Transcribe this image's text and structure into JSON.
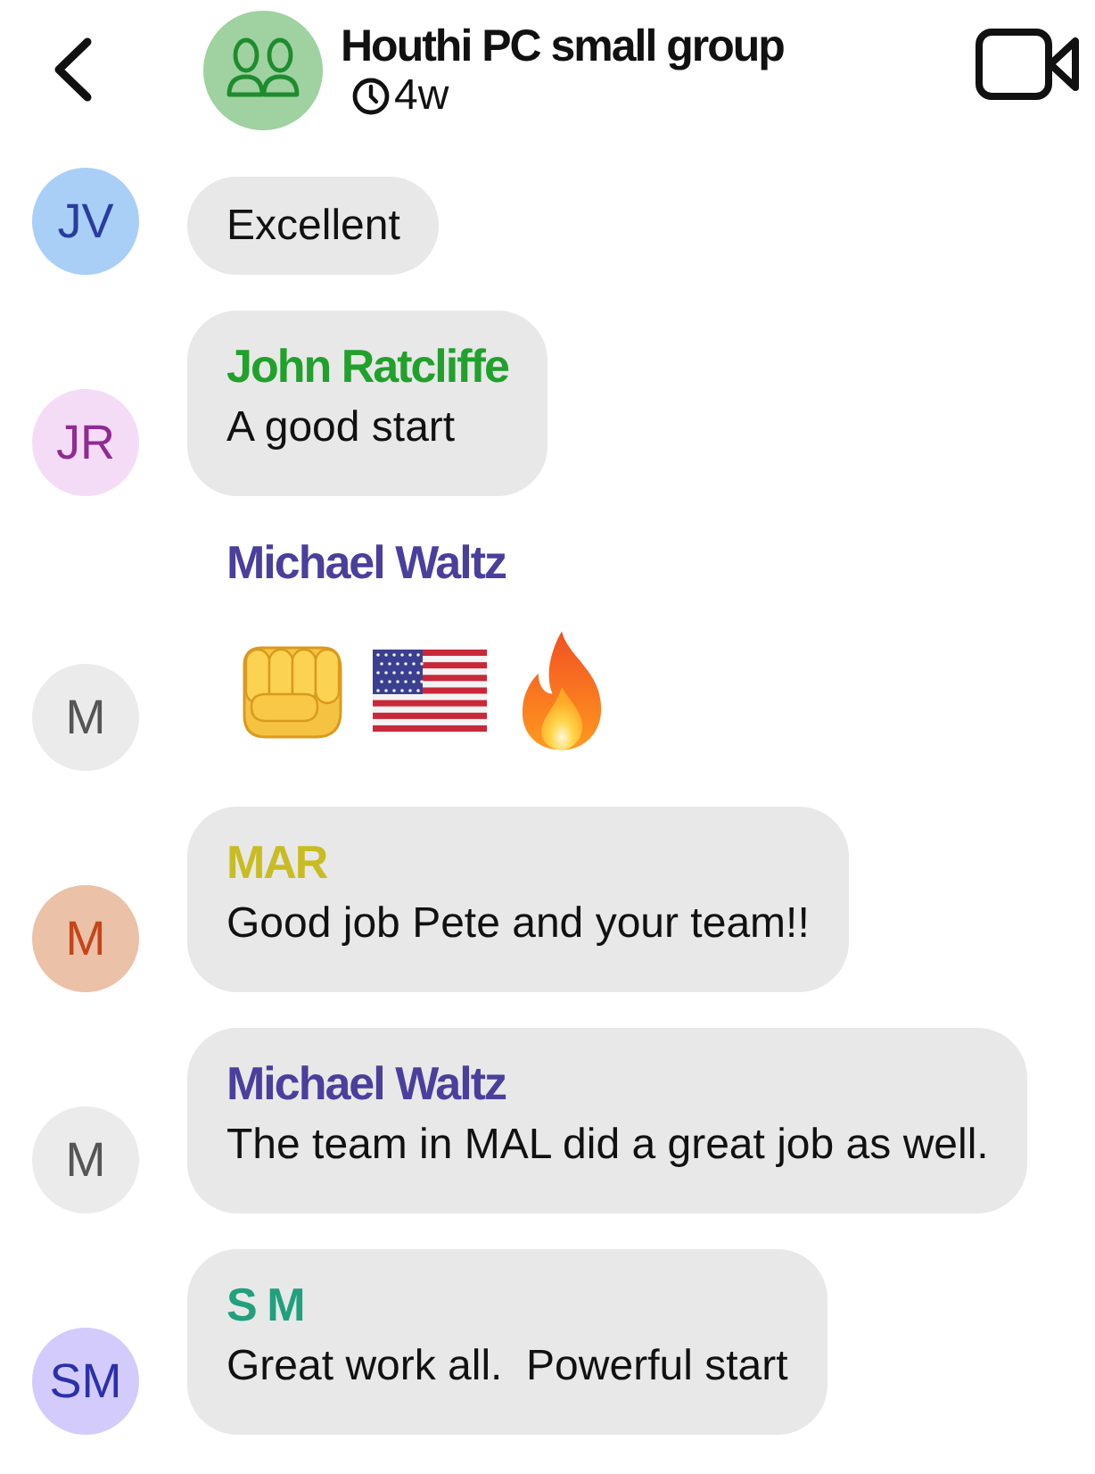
{
  "header": {
    "title": "Houthi PC small group",
    "subtitle": "4w"
  },
  "messages": [
    {
      "kind": "text",
      "avatar": {
        "color": "#a9cff7",
        "initials": {
          "text": "JV",
          "color": "#2a3d9c"
        }
      },
      "text": "Excellent"
    },
    {
      "kind": "text",
      "avatar": {
        "color": "#f4dcf6",
        "initials": {
          "text": "JR",
          "color": "#8f2b91"
        }
      },
      "sender": {
        "name": "John Ratcliffe",
        "color": "#22a02c"
      },
      "text": "A good start"
    },
    {
      "kind": "emoji",
      "avatar": {
        "color": "#ebebeb",
        "initials": {
          "text": "M",
          "color": "#555555"
        }
      },
      "sender": {
        "name": "Michael Waltz",
        "color": "#4a3f9c"
      },
      "emojis": [
        {
          "kind": "fist"
        },
        {
          "kind": "flag"
        },
        {
          "kind": "fire"
        }
      ]
    },
    {
      "kind": "text",
      "avatar": {
        "color": "#ebc1a8",
        "initials": {
          "text": "M",
          "color": "#c4451c"
        }
      },
      "sender": {
        "name": "MAR",
        "color": "#c8bc22"
      },
      "text": "Good job Pete and your team!!"
    },
    {
      "kind": "text",
      "avatar": {
        "color": "#ebebeb",
        "initials": {
          "text": "M",
          "color": "#555555"
        }
      },
      "sender": {
        "name": "Michael Waltz",
        "color": "#4a3f9c"
      },
      "text": "The team in MAL did a great job as well."
    },
    {
      "kind": "text",
      "avatar": {
        "color": "#d3cbfc",
        "initials": {
          "text": "SM",
          "color": "#2c30a8"
        }
      },
      "sender": {
        "name": "S M",
        "color": "#21a07e"
      },
      "text": "Great work all.  Powerful start"
    }
  ]
}
